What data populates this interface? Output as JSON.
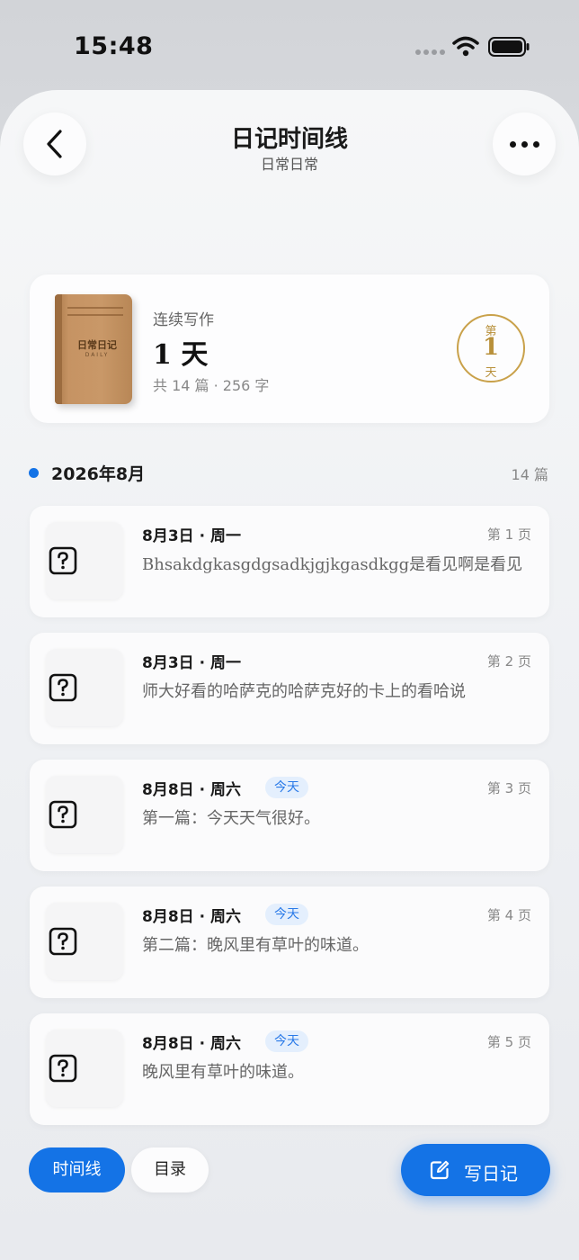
{
  "status": {
    "time": "15:48"
  },
  "header": {
    "title": "日记时间线",
    "subtitle": "日常日常"
  },
  "streak": {
    "book_title": "日常日记",
    "book_sub": "DAILY",
    "label": "连续写作",
    "value": "1 天",
    "stats": "共 14 篇 · 256 字",
    "badge_top": "第",
    "badge_num": "1",
    "badge_bottom": "天"
  },
  "month": {
    "label": "2026年8月",
    "count": "14 篇"
  },
  "entries": [
    {
      "date": "8月3日 · 周一",
      "page": "第 1 页",
      "text": "Bhsakdgkasgdgsadkjgjkgasdkgg是看见啊是看见",
      "badge": ""
    },
    {
      "date": "8月3日 · 周一",
      "page": "第 2 页",
      "text": "师大好看的哈萨克的哈萨克好的卡上的看哈说",
      "badge": ""
    },
    {
      "date": "8月8日 · 周六",
      "page": "第 3 页",
      "text": "第一篇：今天天气很好。",
      "badge": "今天"
    },
    {
      "date": "8月8日 · 周六",
      "page": "第 4 页",
      "text": "第二篇：晚风里有草叶的味道。",
      "badge": "今天"
    },
    {
      "date": "8月8日 · 周六",
      "page": "第 5 页",
      "text": "晚风里有草叶的味道。",
      "badge": "今天"
    }
  ],
  "bottom": {
    "timeline": "时间线",
    "catalog": "目录",
    "write": "写日记"
  },
  "colors": {
    "accent": "#1473e6",
    "gold": "#c9a14a",
    "today_bg": "#e4effd"
  },
  "icons": [
    "back-arrow-icon",
    "more-icon",
    "unknown-image-icon",
    "edit-icon",
    "wifi-icon",
    "battery-icon",
    "signal-icon"
  ]
}
